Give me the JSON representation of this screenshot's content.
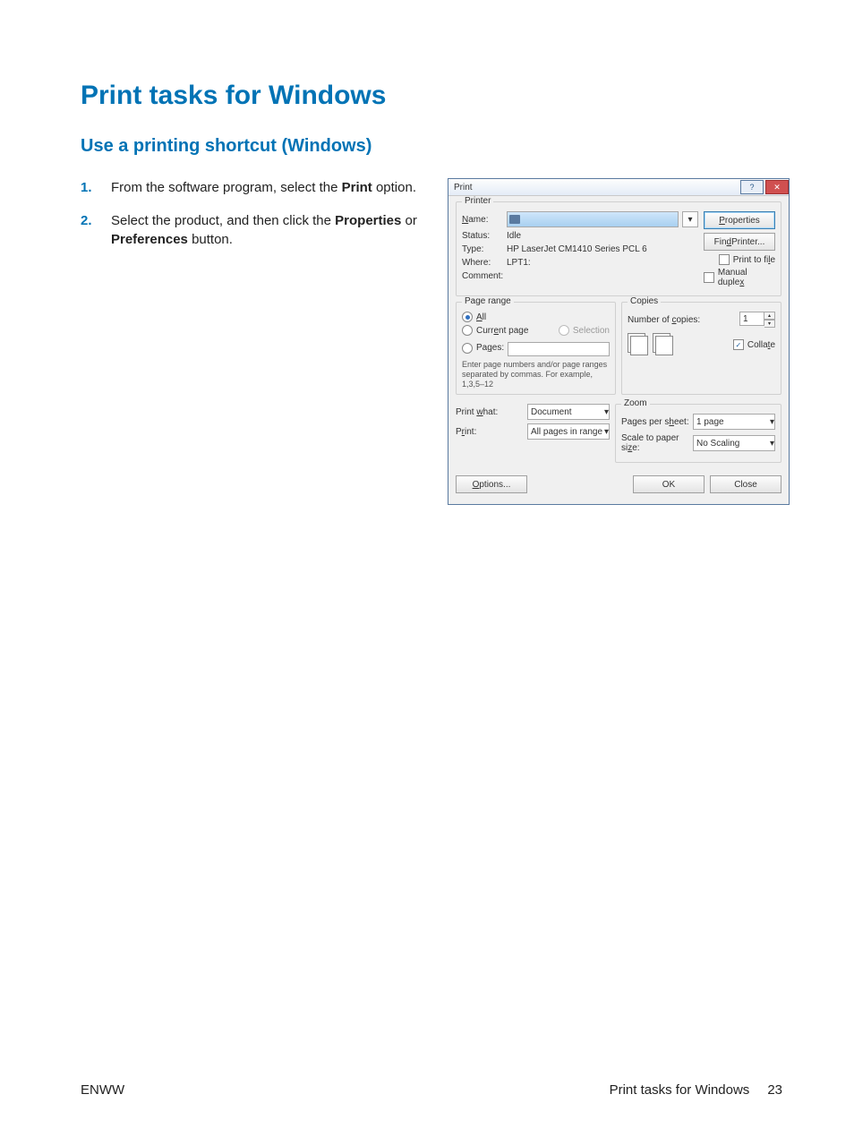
{
  "page": {
    "title": "Print tasks for Windows",
    "subtitle": "Use a printing shortcut (Windows)",
    "steps": [
      {
        "num": "1.",
        "pre": "From the software program, select the ",
        "b1": "Print",
        "post": " option."
      },
      {
        "num": "2.",
        "pre": "Select the product, and then click the ",
        "b1": "Properties",
        "mid": " or ",
        "b2": "Preferences",
        "post": " button."
      }
    ],
    "footer_left": "ENWW",
    "footer_right": "Print tasks for Windows",
    "footer_page": "23"
  },
  "dialog": {
    "title": "Print",
    "printer": {
      "group": "Printer",
      "name_label": "Name:",
      "status_label": "Status:",
      "status": "Idle",
      "type_label": "Type:",
      "type": "HP LaserJet CM1410 Series PCL 6",
      "where_label": "Where:",
      "where": "LPT1:",
      "comment_label": "Comment:",
      "properties_btn": "Properties",
      "find_printer_btn": "Find Printer...",
      "print_to_file": "Print to file",
      "manual_duplex": "Manual duplex"
    },
    "range": {
      "group": "Page range",
      "all": "All",
      "current": "Current page",
      "selection": "Selection",
      "pages": "Pages:",
      "hint": "Enter page numbers and/or page ranges separated by commas.  For example, 1,3,5–12"
    },
    "copies": {
      "group": "Copies",
      "num_label": "Number of copies:",
      "num_value": "1",
      "collate": "Collate"
    },
    "printwhat": {
      "label": "Print what:",
      "value": "Document",
      "print_label": "Print:",
      "print_value": "All pages in range"
    },
    "zoom": {
      "group": "Zoom",
      "pps_label": "Pages per sheet:",
      "pps_value": "1 page",
      "scale_label": "Scale to paper size:",
      "scale_value": "No Scaling"
    },
    "buttons": {
      "options": "Options...",
      "ok": "OK",
      "close": "Close"
    }
  }
}
